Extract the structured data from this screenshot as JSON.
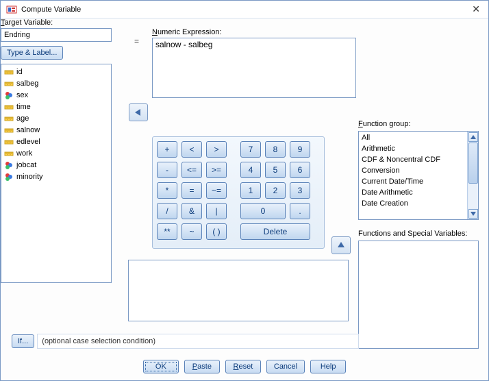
{
  "window": {
    "title": "Compute Variable"
  },
  "labels": {
    "target_variable": "Target Variable:",
    "numeric_expression_pre": "N",
    "numeric_expression_post": "umeric Expression:",
    "function_group_pre": "F",
    "function_group_post": "unction group:",
    "functions_vars": "Functions and Special Variables:",
    "equals": "="
  },
  "inputs": {
    "target_variable_value": "Endring",
    "numeric_expression_value": "salnow - salbeg"
  },
  "buttons": {
    "type_label": "Type & Label...",
    "if": "If...",
    "ok": "OK",
    "paste": "Paste",
    "reset": "Reset",
    "cancel": "Cancel",
    "help": "Help",
    "delete": "Delete"
  },
  "if_text": "(optional case selection condition)",
  "variables": [
    {
      "name": "id",
      "icon": "ruler"
    },
    {
      "name": "salbeg",
      "icon": "ruler"
    },
    {
      "name": "sex",
      "icon": "balls"
    },
    {
      "name": "time",
      "icon": "ruler"
    },
    {
      "name": "age",
      "icon": "ruler"
    },
    {
      "name": "salnow",
      "icon": "ruler"
    },
    {
      "name": "edlevel",
      "icon": "ruler"
    },
    {
      "name": "work",
      "icon": "ruler"
    },
    {
      "name": "jobcat",
      "icon": "balls"
    },
    {
      "name": "minority",
      "icon": "balls"
    }
  ],
  "keypad": {
    "row1_ops": [
      "+",
      "<",
      ">"
    ],
    "row1_nums": [
      "7",
      "8",
      "9"
    ],
    "row2_ops": [
      "-",
      "<=",
      ">="
    ],
    "row2_nums": [
      "4",
      "5",
      "6"
    ],
    "row3_ops": [
      "*",
      "=",
      "~="
    ],
    "row3_nums": [
      "1",
      "2",
      "3"
    ],
    "row4_ops": [
      "/",
      "&",
      "|"
    ],
    "row4_nums_zero": "0",
    "row4_dot": ".",
    "row5_ops": [
      "**",
      "~",
      "( )"
    ]
  },
  "function_groups": [
    "All",
    "Arithmetic",
    "CDF & Noncentral CDF",
    "Conversion",
    "Current Date/Time",
    "Date Arithmetic",
    "Date Creation"
  ]
}
